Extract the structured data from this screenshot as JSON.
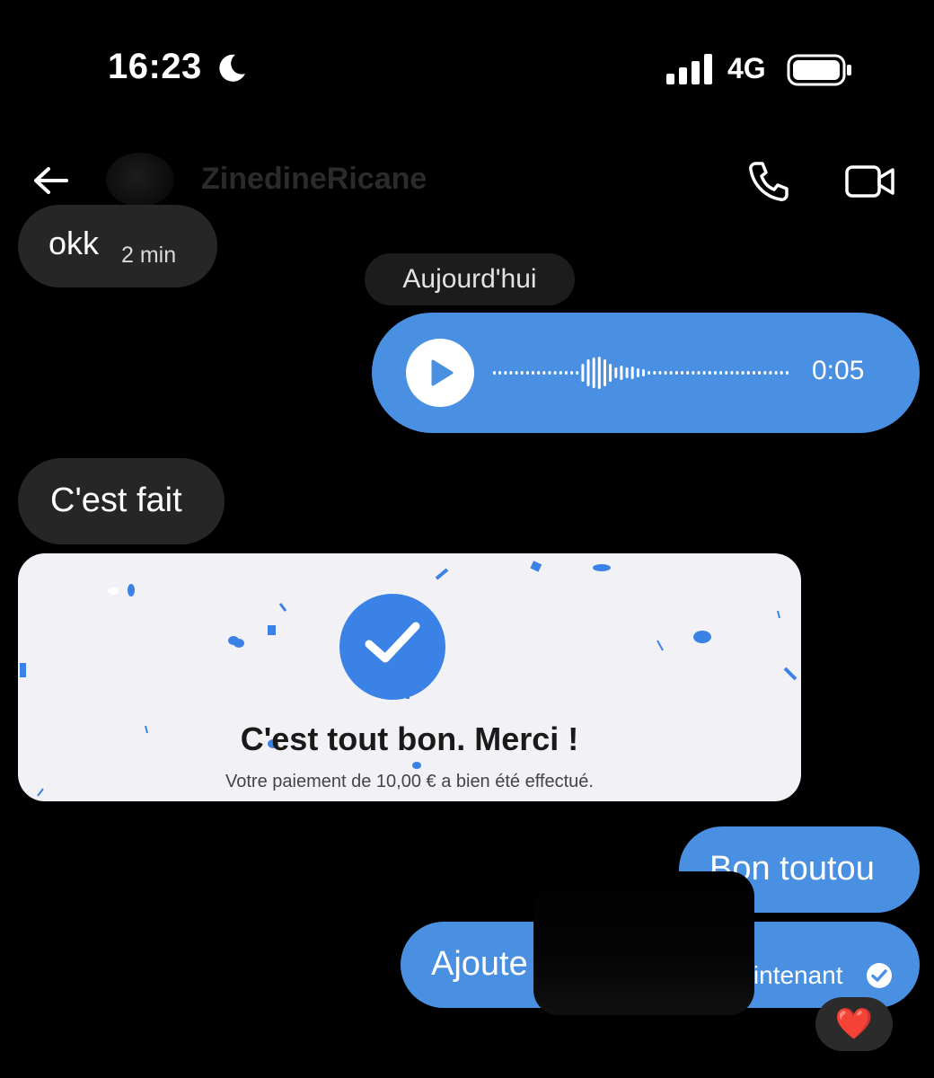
{
  "status_bar": {
    "time": "16:23",
    "network": "4G",
    "icons": [
      "moon-icon",
      "signal-icon",
      "battery-icon"
    ]
  },
  "header": {
    "contact_name": "ZinedineRicane",
    "icons": [
      "back-arrow-icon",
      "phone-icon",
      "video-camera-icon"
    ]
  },
  "conversation": {
    "messages": [
      {
        "from": "them",
        "text": "okk",
        "timestamp": "2 min"
      },
      {
        "type": "date_separator",
        "text": "Aujourd'hui"
      },
      {
        "from": "me",
        "type": "voice",
        "duration": "0:05"
      },
      {
        "from": "them",
        "text": "C'est fait"
      },
      {
        "from": "them",
        "type": "image",
        "title": "C'est tout bon. Merci !",
        "subtitle": "Votre paiement de 10,00 € a bien été effectué."
      },
      {
        "from": "me",
        "text": "Bon toutou"
      },
      {
        "from": "me",
        "text": "Ajoute",
        "status": "Maintenant",
        "reaction": "❤️"
      }
    ]
  },
  "colors": {
    "background": "#000000",
    "incoming_bubble": "#262626",
    "outgoing_bubble": "#4a90e2",
    "check_accent": "#3b82e6"
  }
}
